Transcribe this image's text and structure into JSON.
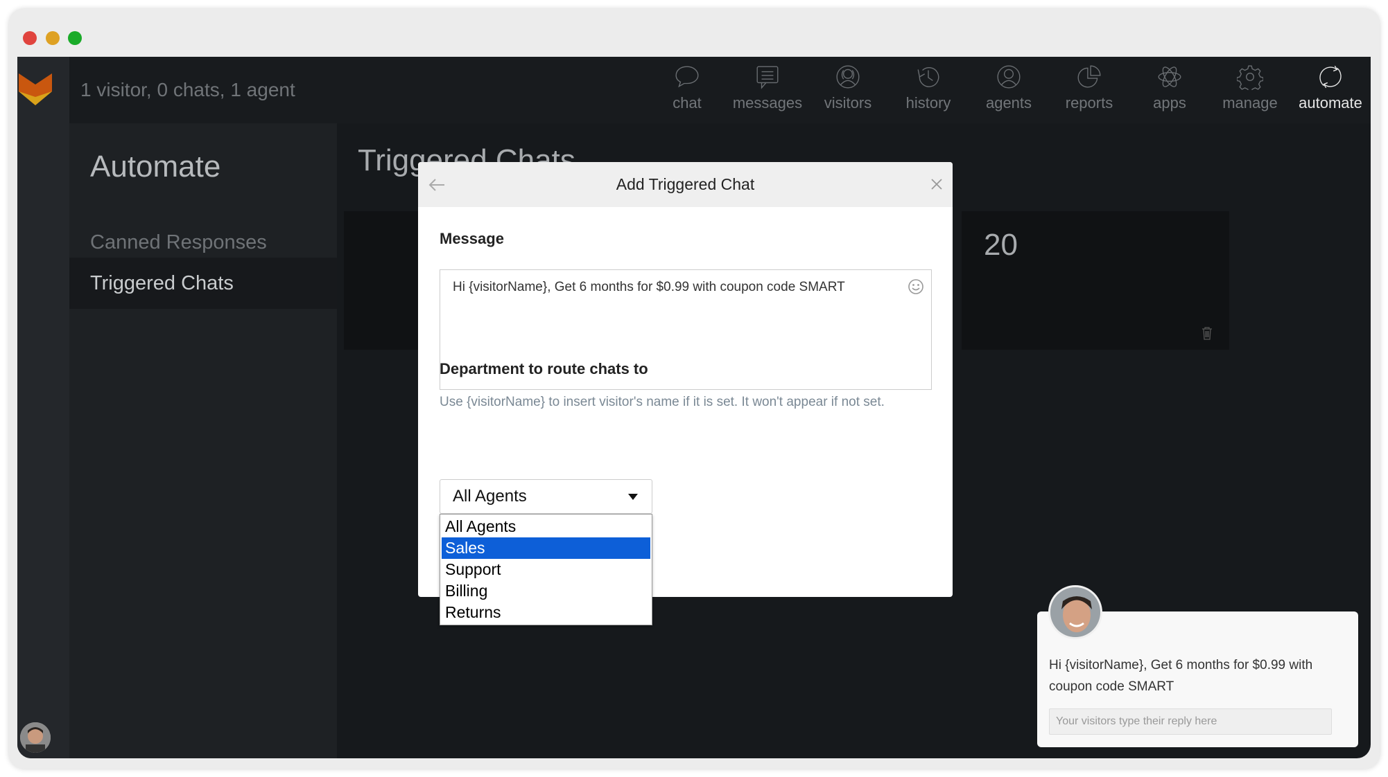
{
  "window": {
    "traffic_lights": [
      "#e0443e",
      "#dea123",
      "#1aab29"
    ]
  },
  "header": {
    "status": "1 visitor, 0 chats, 1 agent",
    "nav": [
      {
        "label": "chat",
        "icon": "chat-bubble-icon"
      },
      {
        "label": "messages",
        "icon": "message-icon"
      },
      {
        "label": "visitors",
        "icon": "visitors-icon"
      },
      {
        "label": "history",
        "icon": "history-icon"
      },
      {
        "label": "agents",
        "icon": "agent-icon"
      },
      {
        "label": "reports",
        "icon": "pie-chart-icon"
      },
      {
        "label": "apps",
        "icon": "atom-icon"
      },
      {
        "label": "manage",
        "icon": "gear-icon"
      },
      {
        "label": "automate",
        "icon": "refresh-icon",
        "active": true
      }
    ]
  },
  "sidebar": {
    "title": "Automate",
    "items": [
      {
        "label": "Canned Responses"
      },
      {
        "label": "Triggered Chats",
        "active": true
      }
    ]
  },
  "main": {
    "title": "Triggered Chats",
    "card_value": "20"
  },
  "modal": {
    "title": "Add Triggered Chat",
    "message_label": "Message",
    "message_value": "Hi {visitorName}, Get 6 months for $0.99 with coupon code SMART",
    "hint": "Use {visitorName} to insert visitor's name if it is set. It won't appear if not set.",
    "department_label": "Department to route chats to",
    "department_selected": "All Agents",
    "department_options": [
      "All Agents",
      "Sales",
      "Support",
      "Billing",
      "Returns"
    ],
    "highlighted_option": "Sales",
    "highlight_color": "#0d5fd8"
  },
  "widget": {
    "message": "Hi {visitorName}, Get 6 months for $0.99 with coupon code SMART",
    "reply_placeholder": "Your visitors type their reply here"
  }
}
